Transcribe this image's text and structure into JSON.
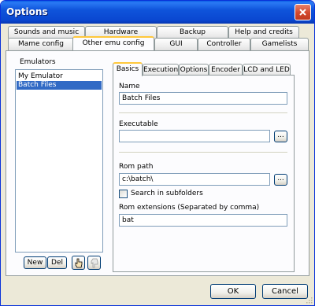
{
  "window": {
    "title": "Options"
  },
  "tabs_top_row": [
    "Sounds and music",
    "Hardware",
    "Backup",
    "Help and credits"
  ],
  "tabs_bottom_row": [
    "Mame config",
    "Other emu config",
    "GUI",
    "Controller",
    "Gamelists"
  ],
  "emulators": {
    "label": "Emulators",
    "items": [
      "My Emulator",
      "Batch Files"
    ],
    "selected": "Batch Files",
    "new_label": "New",
    "del_label": "Del"
  },
  "inner_tabs": [
    "Basics",
    "Execution",
    "Options",
    "Encoder",
    "LCD and LED"
  ],
  "basics": {
    "name_label": "Name",
    "name_value": "Batch Files",
    "executable_label": "Executable",
    "executable_value": "",
    "browse_label": "...",
    "rom_path_label": "Rom path",
    "rom_path_value": "c:\\batch\\",
    "search_subfolders_label": "Search in subfolders",
    "search_subfolders_checked": false,
    "rom_extensions_label": "Rom extensions (Separated by comma)",
    "rom_extensions_value": "bat"
  },
  "footer": {
    "ok_label": "OK",
    "cancel_label": "Cancel"
  },
  "icons": {
    "close": "close-icon",
    "move_up": "hand-up-icon",
    "move_down": "hand-down-icon"
  }
}
